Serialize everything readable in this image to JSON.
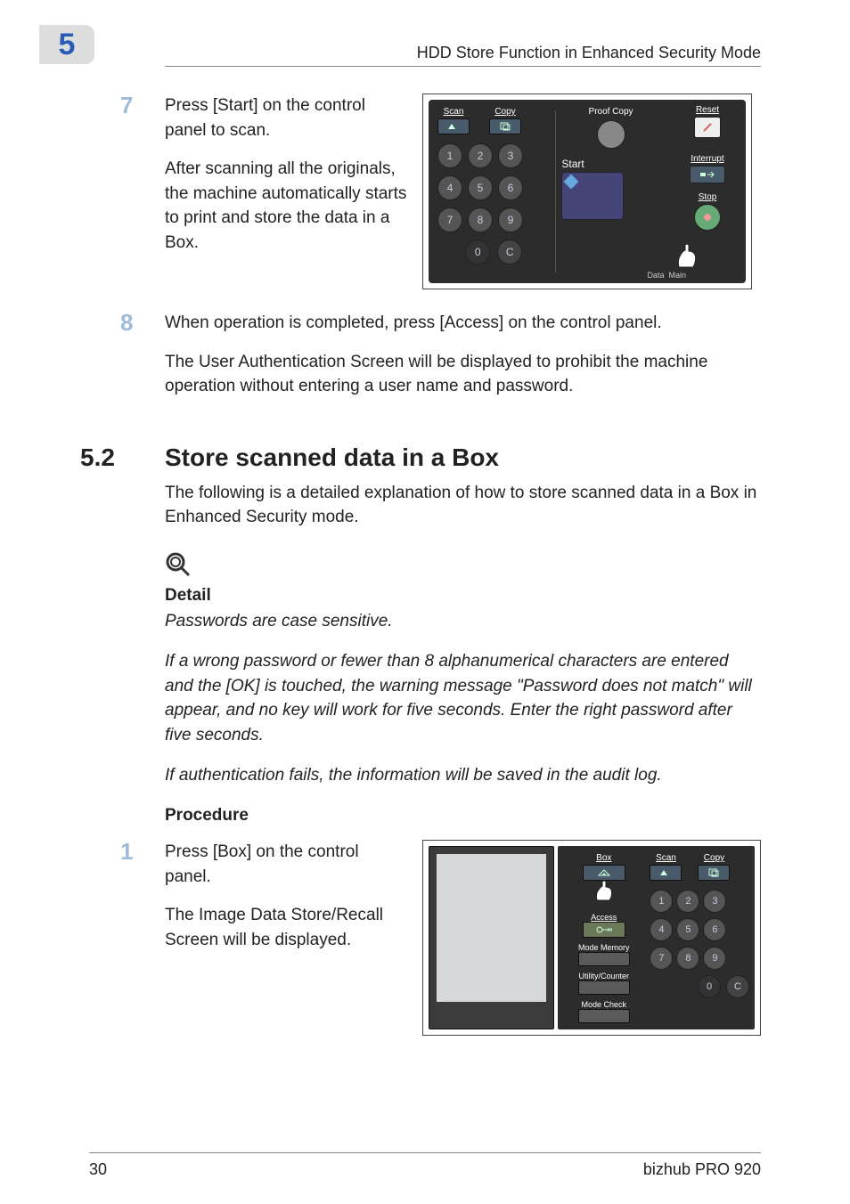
{
  "chapter_badge": "5",
  "header": "HDD Store Function in Enhanced Security Mode",
  "step7": {
    "num": "7",
    "p1": "Press [Start] on the control panel to scan.",
    "p2": "After scanning all the originals, the machine automatically starts to print and store the data in a Box."
  },
  "panel1": {
    "scan": "Scan",
    "copy": "Copy",
    "reset": "Reset",
    "interrupt": "Interrupt",
    "stop": "Stop",
    "proof": "Proof Copy",
    "start": "Start",
    "data": "Data",
    "main": "Main",
    "keys": [
      "1",
      "2",
      "3",
      "4",
      "5",
      "6",
      "7",
      "8",
      "9"
    ],
    "zero": "0",
    "c": "C"
  },
  "step8": {
    "num": "8",
    "p1": "When operation is completed, press [Access] on the control panel.",
    "p2": "The User Authentication Screen will be displayed to prohibit the machine operation without entering a user name and password."
  },
  "section": {
    "num": "5.2",
    "title": "Store scanned data in a Box",
    "intro": "The following is a detailed explanation of how to store scanned data in a Box in Enhanced Security mode."
  },
  "detail": {
    "head": "Detail",
    "p1": "Passwords are case sensitive.",
    "p2": "If a wrong password or fewer than 8 alphanumerical characters are entered and the [OK] is touched, the warning message \"Password does not match\" will appear, and no key will work for five seconds. Enter the right password after five seconds.",
    "p3": "If authentication fails, the information will be saved in the audit log."
  },
  "procedure_head": "Procedure",
  "step1": {
    "num": "1",
    "p1": "Press [Box] on the control panel.",
    "p2": "The Image Data Store/Recall Screen will be displayed."
  },
  "panel2": {
    "box": "Box",
    "scan": "Scan",
    "copy": "Copy",
    "access": "Access",
    "mode_memory": "Mode Memory",
    "utility": "Utility/Counter",
    "mode_check": "Mode Check",
    "keys": [
      "1",
      "2",
      "3",
      "4",
      "5",
      "6",
      "7",
      "8",
      "9"
    ],
    "zero": "0",
    "c": "C"
  },
  "footer": {
    "left": "30",
    "right": "bizhub PRO 920"
  }
}
